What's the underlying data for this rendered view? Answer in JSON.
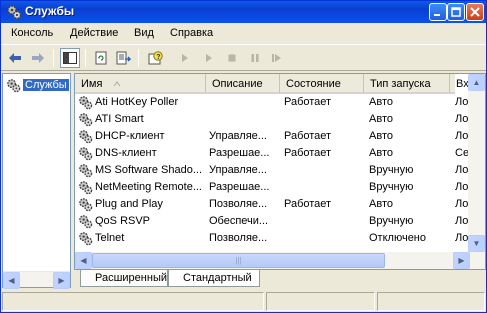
{
  "window": {
    "title": "Службы"
  },
  "menu": [
    "Консоль",
    "Действие",
    "Вид",
    "Справка"
  ],
  "tree": {
    "items": [
      {
        "label": "Службы"
      }
    ]
  },
  "columns": [
    "Имя",
    "Описание",
    "Состояние",
    "Тип запуска",
    "Вх"
  ],
  "services": [
    {
      "name": "Ati HotKey Poller",
      "description": "",
      "status": "Работает",
      "startup": "Авто",
      "logon": "Ло"
    },
    {
      "name": "ATI Smart",
      "description": "",
      "status": "",
      "startup": "Авто",
      "logon": "Ло"
    },
    {
      "name": "DHCP-клиент",
      "description": "Управляе...",
      "status": "Работает",
      "startup": "Авто",
      "logon": "Ло"
    },
    {
      "name": "DNS-клиент",
      "description": "Разрешае...",
      "status": "Работает",
      "startup": "Авто",
      "logon": "Се"
    },
    {
      "name": "MS Software Shado...",
      "description": "Управляе...",
      "status": "",
      "startup": "Вручную",
      "logon": "Ло"
    },
    {
      "name": "NetMeeting Remote...",
      "description": "Разрешае...",
      "status": "",
      "startup": "Вручную",
      "logon": "Ло"
    },
    {
      "name": "Plug and Play",
      "description": "Позволяе...",
      "status": "Работает",
      "startup": "Авто",
      "logon": "Ло"
    },
    {
      "name": "QoS RSVP",
      "description": "Обеспечи...",
      "status": "",
      "startup": "Вручную",
      "logon": "Ло"
    },
    {
      "name": "Telnet",
      "description": "Позволяе...",
      "status": "",
      "startup": "Отключено",
      "logon": "Ло"
    }
  ],
  "tabs": [
    "Расширенный",
    "Стандартный"
  ],
  "colors": {
    "titlebar": "#0a46dc",
    "selection": "#316ac5"
  }
}
